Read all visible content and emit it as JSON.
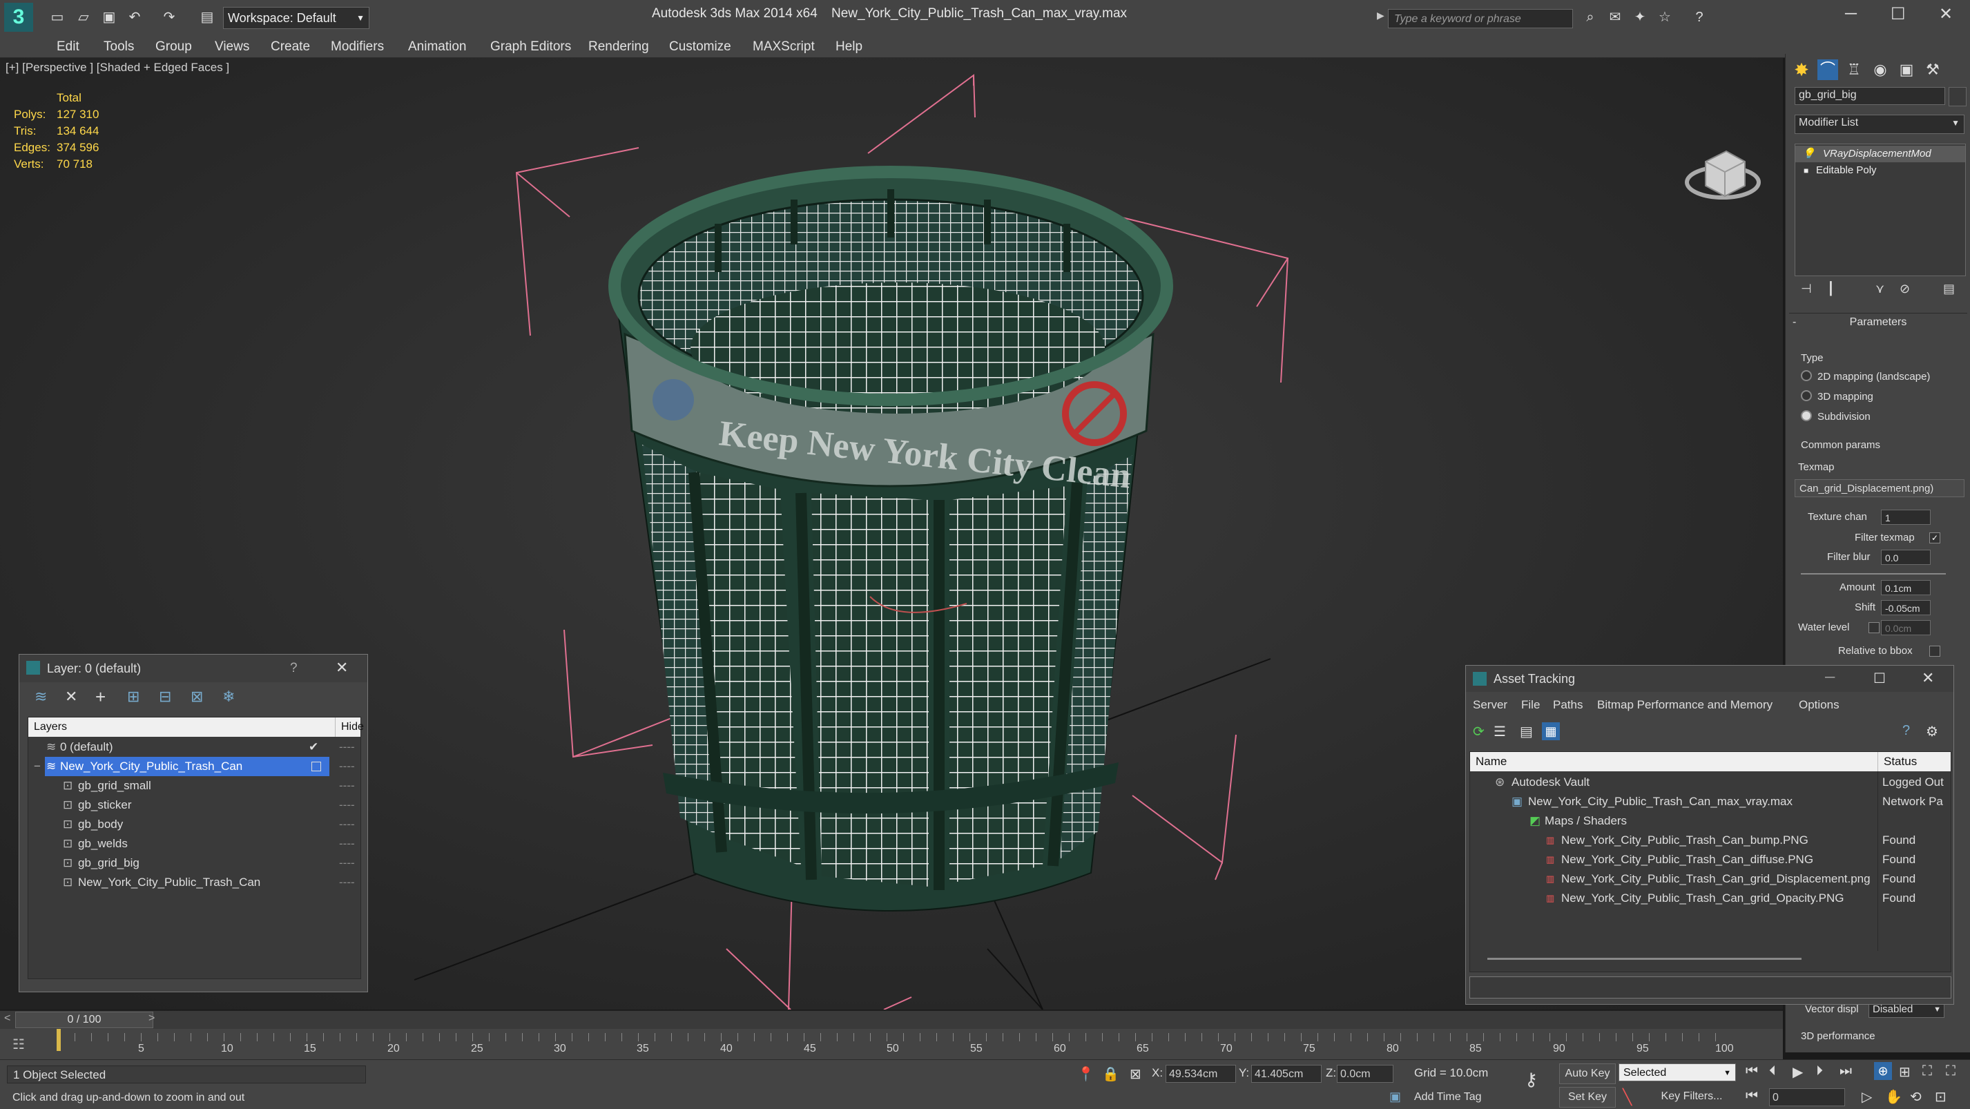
{
  "titlebar": {
    "workspace": "Workspace: Default",
    "app_title": "Autodesk 3ds Max  2014 x64",
    "file_title": "New_York_City_Public_Trash_Can_max_vray.max",
    "search_placeholder": "Type a keyword or phrase"
  },
  "menu": [
    "Edit",
    "Tools",
    "Group",
    "Views",
    "Create",
    "Modifiers",
    "Animation",
    "Graph Editors",
    "Rendering",
    "Customize",
    "MAXScript",
    "Help"
  ],
  "viewport": {
    "label": "[+] [Perspective ] [Shaded + Edged Faces ]",
    "stats_header": "Total",
    "stats": [
      {
        "label": "Polys:",
        "value": "127 310"
      },
      {
        "label": "Tris:",
        "value": "134 644"
      },
      {
        "label": "Edges:",
        "value": "374 596"
      },
      {
        "label": "Verts:",
        "value": "70 718"
      }
    ],
    "can_text": "Keep New York City Clean"
  },
  "command_panel": {
    "object_name": "gb_grid_big",
    "modifier_list": "Modifier List",
    "stack": [
      "VRayDisplacementMod",
      "Editable Poly"
    ],
    "rollout": "Parameters",
    "type_label": "Type",
    "type_options": [
      {
        "label": "2D mapping (landscape)",
        "selected": false
      },
      {
        "label": "3D mapping",
        "selected": false
      },
      {
        "label": "Subdivision",
        "selected": true
      }
    ],
    "common_params": "Common params",
    "texmap_label": "Texmap",
    "texmap_value": "Can_grid_Displacement.png)",
    "texture_chan_label": "Texture chan",
    "texture_chan_value": "1",
    "filter_texmap_label": "Filter texmap",
    "filter_blur_label": "Filter blur",
    "filter_blur_value": "0.0",
    "amount_label": "Amount",
    "amount_value": "0.1cm",
    "shift_label": "Shift",
    "shift_value": "-0.05cm",
    "water_level_label": "Water level",
    "water_level_value": "0.0cm",
    "relative_bbox_label": "Relative to bbox",
    "vector_disp_label": "Vector displ",
    "vector_disp_value": "Disabled",
    "perf_label": "3D performance"
  },
  "layer_dialog": {
    "title": "Layer: 0 (default)",
    "help": "?",
    "col_layers": "Layers",
    "col_hide": "Hide",
    "rows": [
      {
        "name": "0 (default)",
        "indent": 0,
        "selected": false,
        "current": true
      },
      {
        "name": "New_York_City_Public_Trash_Can",
        "indent": 0,
        "selected": true,
        "current": false
      },
      {
        "name": "gb_grid_small",
        "indent": 1,
        "selected": false,
        "current": false
      },
      {
        "name": "gb_sticker",
        "indent": 1,
        "selected": false,
        "current": false
      },
      {
        "name": "gb_body",
        "indent": 1,
        "selected": false,
        "current": false
      },
      {
        "name": "gb_welds",
        "indent": 1,
        "selected": false,
        "current": false
      },
      {
        "name": "gb_grid_big",
        "indent": 1,
        "selected": false,
        "current": false
      },
      {
        "name": "New_York_City_Public_Trash_Can",
        "indent": 1,
        "selected": false,
        "current": false
      }
    ]
  },
  "asset_dialog": {
    "title": "Asset Tracking",
    "menu": [
      "Server",
      "File",
      "Paths",
      "Bitmap Performance and Memory",
      "Options"
    ],
    "col_name": "Name",
    "col_status": "Status",
    "rows": [
      {
        "name": "Autodesk Vault",
        "indent": 0,
        "status": "Logged Out"
      },
      {
        "name": "New_York_City_Public_Trash_Can_max_vray.max",
        "indent": 1,
        "status": "Network Pa"
      },
      {
        "name": "Maps / Shaders",
        "indent": 2,
        "status": ""
      },
      {
        "name": "New_York_City_Public_Trash_Can_bump.PNG",
        "indent": 3,
        "status": "Found"
      },
      {
        "name": "New_York_City_Public_Trash_Can_diffuse.PNG",
        "indent": 3,
        "status": "Found"
      },
      {
        "name": "New_York_City_Public_Trash_Can_grid_Displacement.png",
        "indent": 3,
        "status": "Found"
      },
      {
        "name": "New_York_City_Public_Trash_Can_grid_Opacity.PNG",
        "indent": 3,
        "status": "Found"
      }
    ]
  },
  "timeline": {
    "frame": "0 / 100",
    "ticks": [
      "5",
      "10",
      "15",
      "20",
      "25",
      "30",
      "35",
      "40",
      "45",
      "50",
      "55",
      "60",
      "65",
      "70",
      "75",
      "80",
      "85",
      "90",
      "95",
      "100"
    ]
  },
  "status": {
    "selection": "1 Object Selected",
    "prompt": "Click and drag up-and-down to zoom in and out",
    "x_label": "X:",
    "x_value": "49.534cm",
    "y_label": "Y:",
    "y_value": "41.405cm",
    "z_label": "Z:",
    "z_value": "0.0cm",
    "grid": "Grid = 10.0cm",
    "auto_key": "Auto Key",
    "set_key": "Set Key",
    "selected_value": "Selected",
    "key_filters": "Key Filters...",
    "add_time_tag": "Add Time Tag",
    "frame_value": "0"
  },
  "colors": {
    "selection": "#3b73d9",
    "stat": "#ffd84a",
    "can_green": "#2e5a48"
  }
}
